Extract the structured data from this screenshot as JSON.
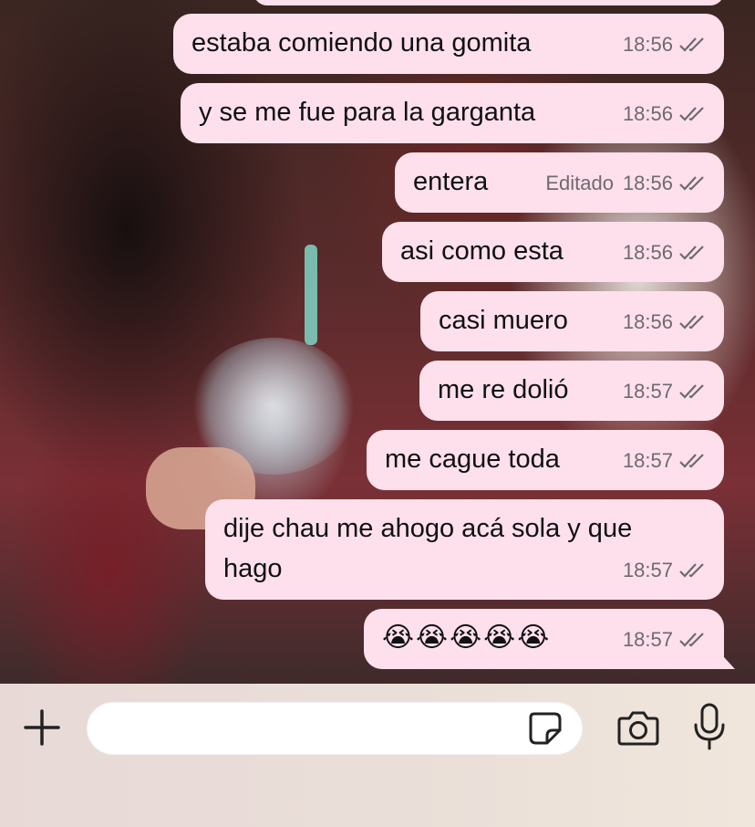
{
  "messages": [
    {
      "text": "estaba comiendo una gomita",
      "time": "18:56",
      "edited": ""
    },
    {
      "text": "y se me fue para la garganta",
      "time": "18:56",
      "edited": ""
    },
    {
      "text": "entera",
      "time": "18:56",
      "edited": "Editado"
    },
    {
      "text": "asi como esta",
      "time": "18:56",
      "edited": ""
    },
    {
      "text": "casi muero",
      "time": "18:56",
      "edited": ""
    },
    {
      "text": "me re dolió",
      "time": "18:57",
      "edited": ""
    },
    {
      "text": "me cague toda",
      "time": "18:57",
      "edited": ""
    },
    {
      "text": "dije chau me ahogo acá sola y que\nhago",
      "time": "18:57",
      "edited": ""
    },
    {
      "text": "😭😭😭😭😭",
      "time": "18:57",
      "edited": ""
    }
  ],
  "input": {
    "placeholder": "",
    "value": ""
  },
  "icons": {
    "attach": "plus-icon",
    "sticker": "sticker-icon",
    "camera": "camera-icon",
    "mic": "microphone-icon",
    "read": "double-check-icon"
  },
  "colors": {
    "bubble": "#fde0ec",
    "meta": "#6f6a6c"
  }
}
